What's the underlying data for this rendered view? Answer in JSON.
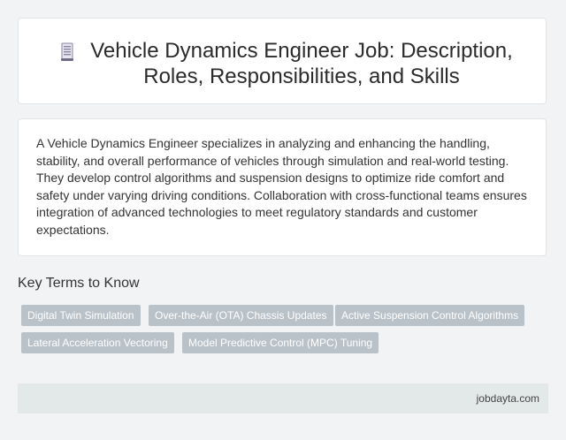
{
  "header": {
    "title": "Vehicle Dynamics Engineer Job: Description, Roles, Responsibilities, and Skills",
    "icon": "document-icon"
  },
  "description": {
    "text": "A Vehicle Dynamics Engineer specializes in analyzing and enhancing the handling, stability, and overall performance of vehicles through simulation and real-world testing. They develop control algorithms and suspension designs to optimize ride comfort and safety under varying driving conditions. Collaboration with cross-functional teams ensures integration of advanced technologies to meet regulatory standards and customer expectations."
  },
  "key_terms": {
    "heading": "Key Terms to Know",
    "items": [
      "Digital Twin Simulation",
      "Over-the-Air (OTA) Chassis Updates",
      "Active Suspension Control Algorithms",
      "Lateral Acceleration Vectoring",
      "Model Predictive Control (MPC) Tuning"
    ]
  },
  "footer": {
    "site": "jobdayta.com"
  },
  "colors": {
    "background": "#f1f3f4",
    "card": "#ffffff",
    "tag": "#b9c2c9",
    "footer": "#e3e9e8"
  }
}
